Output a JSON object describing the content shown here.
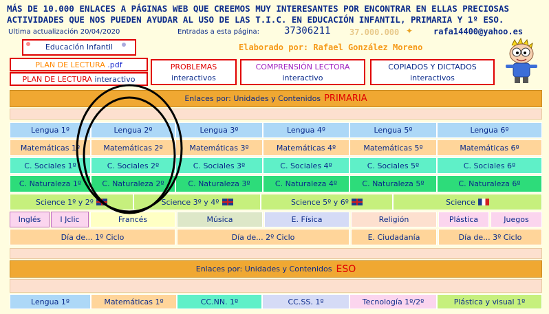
{
  "header": {
    "line1": "MÁS DE 10.000 ENLACES A PÁGINAS WEB QUE CREEMOS MUY INTERESANTES POR ENCONTRAR EN ELLAS PRECIOSAS",
    "line2": "ACTIVIDADES QUE NOS PUEDEN AYUDAR AL USO DE LAS T.I.C. EN EDUCACIÓN INFANTIL, PRIMARIA Y 1º ESO.",
    "updated": "Ultima actualización 20/04/2020",
    "entries_label": "Entradas a esta página:",
    "counter": "37306211",
    "counter_goal": "37.000.000",
    "email": "rafa14400@yahoo.es",
    "author": "Elaborado por: Rafael González Moreno"
  },
  "top_links": {
    "infantil": "Educación Infantil",
    "plan_pdf_a": "PLAN DE LECTURA",
    "plan_pdf_b": ".pdf",
    "plan_int_a": "PLAN DE LECTURA",
    "plan_int_b": "interactivo",
    "problemas_a": "PROBLEMAS",
    "problemas_b": "interactivos",
    "comprension_a": "COMPRENSIÓN LECTORA",
    "comprension_b": "interactivo",
    "copiados_a": "COPIADOS Y DICTADOS",
    "copiados_b": "interactivos"
  },
  "primaria": {
    "band_prefix": "Enlaces por: Unidades y Contenidos",
    "band_highlight": "PRIMARIA",
    "lengua": [
      "Lengua 1º",
      "Lengua 2º",
      "Lengua 3º",
      "Lengua 4º",
      "Lengua 5º",
      "Lengua 6º"
    ],
    "mates": [
      "Matemáticas 1º",
      "Matemáticas 2º",
      "Matemáticas 3º",
      "Matemáticas 4º",
      "Matemáticas 5º",
      "Matemáticas 6º"
    ],
    "sociales": [
      "C. Sociales 1º",
      "C. Sociales 2º",
      "C. Sociales 3º",
      "C. Sociales 4º",
      "C. Sociales 5º",
      "C. Sociales 6º"
    ],
    "naturaleza": [
      "C. Naturaleza 1º",
      "C. Naturaleza 2º",
      "C. Naturaleza 3º",
      "C. Naturaleza 4º",
      "C. Naturaleza 5º",
      "C. Naturaleza 6º"
    ],
    "science": [
      "Science 1º y 2º",
      "Science 3º y 4º",
      "Science 5º y 6º",
      "Science"
    ],
    "misc": [
      "Inglés",
      "I Jclic",
      "Francés",
      "Música",
      "E. Física",
      "Religión",
      "Plástica",
      "Juegos"
    ],
    "dias": [
      "Día de... 1º Ciclo",
      "Día de... 2º Ciclo",
      "E. Ciudadanía",
      "Día de... 3º Ciclo"
    ]
  },
  "eso": {
    "band_prefix": "Enlaces por: Unidades y Contenidos",
    "band_highlight": "ESO",
    "items": [
      "Lengua 1º",
      "Matemáticas 1º",
      "CC.NN. 1º",
      "CC.SS. 1º",
      "Tecnología 1º/2º",
      "Plástica y visual 1º"
    ]
  },
  "colors": {
    "background": "#fffde0",
    "band": "#f0a832",
    "title_blue": "#0a2a8a",
    "red": "#e00000",
    "author_orange": "#f59a1a"
  }
}
